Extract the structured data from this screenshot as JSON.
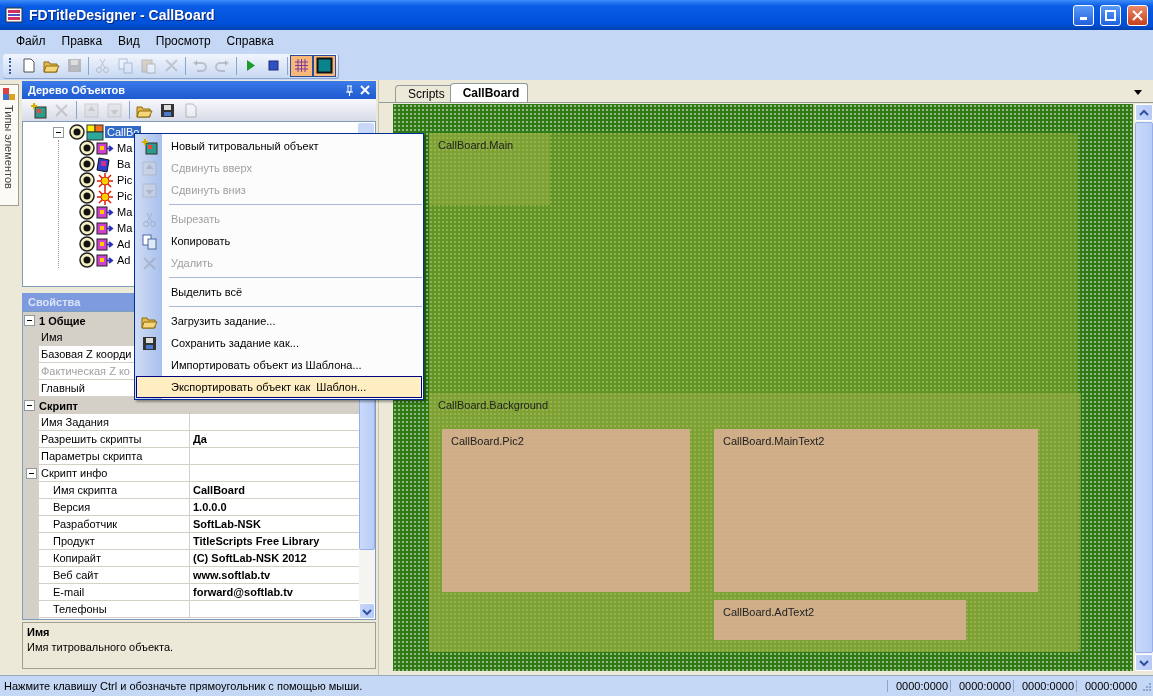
{
  "window": {
    "title": "FDTitleDesigner - CallBoard"
  },
  "menu": [
    "Файл",
    "Правка",
    "Вид",
    "Просмотр",
    "Справка"
  ],
  "toolbar": [
    {
      "kind": "new",
      "disabled": false,
      "pressed": false
    },
    {
      "kind": "open",
      "disabled": false,
      "pressed": false
    },
    {
      "kind": "save",
      "disabled": true,
      "pressed": false
    },
    {
      "kind": "separator"
    },
    {
      "kind": "cut",
      "disabled": true,
      "pressed": false
    },
    {
      "kind": "copy",
      "disabled": true,
      "pressed": false
    },
    {
      "kind": "paste",
      "disabled": true,
      "pressed": false
    },
    {
      "kind": "delete",
      "disabled": true,
      "pressed": false
    },
    {
      "kind": "separator"
    },
    {
      "kind": "undo",
      "disabled": true,
      "pressed": false
    },
    {
      "kind": "redo",
      "disabled": true,
      "pressed": false
    },
    {
      "kind": "separator"
    },
    {
      "kind": "play",
      "disabled": false,
      "pressed": false
    },
    {
      "kind": "stop",
      "disabled": false,
      "pressed": false
    },
    {
      "kind": "separator"
    },
    {
      "kind": "grid",
      "disabled": false,
      "pressed": true
    },
    {
      "kind": "frame",
      "disabled": false,
      "pressed": true
    }
  ],
  "side_tab": {
    "label": "Типы элементов"
  },
  "object_tree": {
    "title": "Дерево Объектов",
    "toolbar": [
      {
        "kind": "add",
        "disabled": false
      },
      {
        "kind": "delete",
        "disabled": true
      },
      {
        "kind": "separator"
      },
      {
        "kind": "up",
        "disabled": true
      },
      {
        "kind": "down",
        "disabled": true
      },
      {
        "kind": "separator"
      },
      {
        "kind": "load",
        "disabled": false
      },
      {
        "kind": "save",
        "disabled": false
      },
      {
        "kind": "page",
        "disabled": true
      }
    ],
    "root": {
      "label": "CallBo",
      "kind": "group",
      "selected": true,
      "expanded": true,
      "children": [
        {
          "label": "Ma",
          "kind": "text",
          "selected": false
        },
        {
          "label": "Ba",
          "kind": "background",
          "selected": false
        },
        {
          "label": "Pic",
          "kind": "picture",
          "selected": false
        },
        {
          "label": "Pic",
          "kind": "picture",
          "selected": false
        },
        {
          "label": "Ma",
          "kind": "text",
          "selected": false
        },
        {
          "label": "Ma",
          "kind": "text",
          "selected": false
        },
        {
          "label": "Ad",
          "kind": "text",
          "selected": false
        },
        {
          "label": "Ad",
          "kind": "text",
          "selected": false
        }
      ]
    }
  },
  "properties": {
    "title": "Свойства",
    "categories": [
      {
        "name": "1 Общие",
        "expanded": true,
        "kind": "category",
        "rows": [
          {
            "name": "Имя",
            "selected": true,
            "disabled": false
          },
          {
            "name": "Базовая Z коорди",
            "selected": false,
            "disabled": false
          },
          {
            "name": "Фактическая Z ко",
            "selected": false,
            "disabled": true
          },
          {
            "name": "Главный",
            "selected": false,
            "disabled": false
          }
        ]
      },
      {
        "name": "Скрипт",
        "expanded": true,
        "kind": "category",
        "rows": [
          {
            "name": "Имя Задания",
            "selected": false,
            "disabled": false
          },
          {
            "name": "Разрешить скрипты",
            "value": "Да",
            "selected": false,
            "disabled": false
          },
          {
            "name": "Параметры скрипта",
            "selected": false,
            "disabled": false
          }
        ]
      },
      {
        "name": "Скрипт инфо",
        "expanded": true,
        "kind": "subcategory",
        "rows": [
          {
            "name": "Имя скрипта",
            "value": "CallBoard",
            "selected": false,
            "disabled": false
          },
          {
            "name": "Версия",
            "value": "1.0.0.0",
            "selected": false,
            "disabled": false
          },
          {
            "name": "Разработчик",
            "value": "SoftLab-NSK",
            "selected": false,
            "disabled": false
          },
          {
            "name": "Продукт",
            "value": "TitleScripts Free Library",
            "selected": false,
            "disabled": false
          },
          {
            "name": "Копирайт",
            "value": "(C) SoftLab-NSK 2012",
            "selected": false,
            "disabled": false
          },
          {
            "name": "Веб сайт",
            "value": "www.softlab.tv",
            "selected": false,
            "disabled": false
          },
          {
            "name": "E-mail",
            "value": "forward@softlab.tv",
            "selected": false,
            "disabled": false
          },
          {
            "name": "Телефоны",
            "selected": false,
            "disabled": false
          }
        ]
      }
    ],
    "description": {
      "title": "Имя",
      "text": "Имя титровального объекта."
    }
  },
  "document_tabs": [
    {
      "label": "Scripts",
      "selected": false
    },
    {
      "label": "CallBoard",
      "selected": true
    }
  ],
  "canvas": {
    "objects": [
      {
        "kind": "area",
        "label": "CallBoard.Main"
      },
      {
        "kind": "area",
        "label": "CallBoard.Background"
      },
      {
        "kind": "box",
        "label": "CallBoard.Pic2"
      },
      {
        "kind": "box",
        "label": "CallBoard.MainText2"
      },
      {
        "kind": "box",
        "label": "CallBoard.AdText2"
      }
    ]
  },
  "context_menu": [
    {
      "kind": "item",
      "label": "Новый титровальный объект",
      "disabled": false,
      "selected": false
    },
    {
      "kind": "item",
      "label": "Сдвинуть вверх",
      "disabled": true,
      "selected": false
    },
    {
      "kind": "item",
      "label": "Сдвинуть вниз",
      "disabled": true,
      "selected": false
    },
    {
      "kind": "separator"
    },
    {
      "kind": "item",
      "label": "Вырезать",
      "disabled": true,
      "selected": false
    },
    {
      "kind": "item",
      "label": "Копировать",
      "disabled": false,
      "selected": false
    },
    {
      "kind": "item",
      "label": "Удалить",
      "disabled": true,
      "selected": false
    },
    {
      "kind": "separator"
    },
    {
      "kind": "item",
      "label": "Выделить всё",
      "disabled": false,
      "selected": false
    },
    {
      "kind": "separator"
    },
    {
      "kind": "item",
      "label": "Загрузить задание...",
      "disabled": false,
      "selected": false
    },
    {
      "kind": "item",
      "label": "Сохранить задание как...",
      "disabled": false,
      "selected": false
    },
    {
      "kind": "item",
      "label": "Импортировать объект из Шаблона...",
      "disabled": false,
      "selected": false
    },
    {
      "kind": "item",
      "label": "Экспортировать объект как  Шаблон...",
      "disabled": false,
      "selected": true
    }
  ],
  "status_bar": {
    "text": "Нажмите клавишу Ctrl и обозначьте прямоугольник с помощью мыши.",
    "panels": [
      "0000:0000",
      "0000:0000",
      "0000:0000",
      "0000:0000"
    ]
  }
}
